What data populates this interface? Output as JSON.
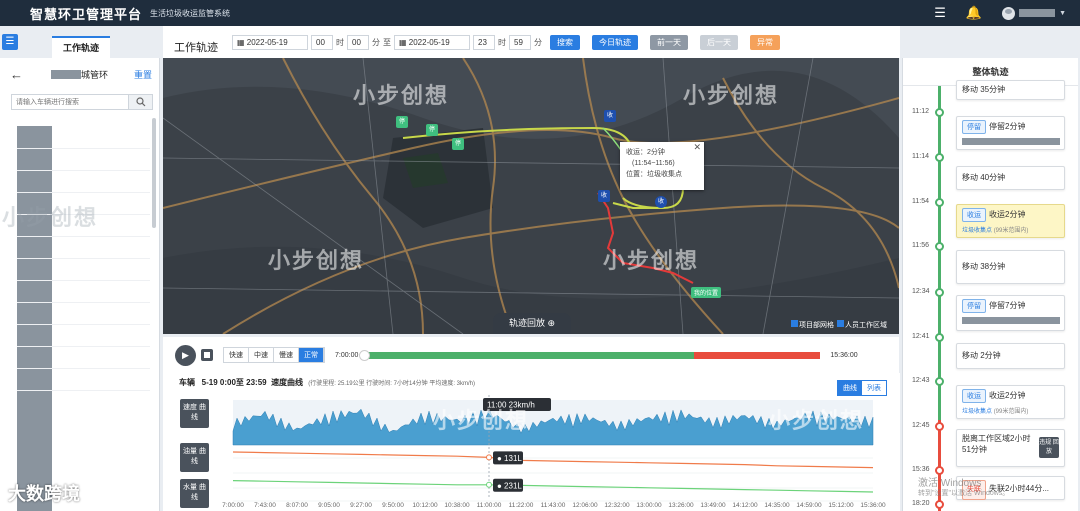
{
  "topbar": {
    "title": "智慧环卫管理平台",
    "subtitle": "生活垃圾收运监管系统",
    "menu_icon": "hamburger-icon",
    "bell_icon": "bell-icon",
    "avatar_icon": "user-avatar-icon"
  },
  "left_panel": {
    "tab_label": "工作轨迹",
    "vehicle_suffix": "城管环",
    "reset_label": "重置",
    "search_placeholder": "请输入车辆进行搜索"
  },
  "toolbar": {
    "title": "工作轨迹",
    "start_date": "2022-05-19",
    "start_hour": "00",
    "hour_unit": "时",
    "start_min": "00",
    "min_unit": "分",
    "to_label": "至",
    "end_date": "2022-05-19",
    "end_hour": "23",
    "end_min": "59",
    "search_btn": "搜索",
    "today_btn": "今日轨迹",
    "prev_btn": "前一天",
    "next_btn": "后一天",
    "exception_btn": "异常",
    "colors": {
      "primary": "#2a7de1",
      "gray": "#8e98a4",
      "disabled": "#c9cfd6",
      "orange": "#f5a15a"
    }
  },
  "map": {
    "popup_line1": "收运：2分钟",
    "popup_line2": "(11:54~11:56)",
    "popup_line3": "位置：垃圾收集点",
    "pos_label": "我的位置",
    "replay_label": "轨迹回放 ⊕",
    "check1": "项目部网格",
    "check2": "人员工作区域",
    "marker_stop": "停",
    "marker_collect": "收"
  },
  "player": {
    "speeds": [
      "快速",
      "中速",
      "慢速",
      "正常"
    ],
    "active_speed": "正常",
    "start_time": "7:00:00",
    "end_time": "15:36:00",
    "progress_fraction": 0.725,
    "colors": {
      "done": "#4cb06a",
      "remaining": "#e84c3d"
    }
  },
  "speed_chart": {
    "vehicle_label": "车辆",
    "range_label": "5-19 0:00至 23:59",
    "chart_title": "速度曲线",
    "meta": "(行驶里程: 25.19公里 行驶时间: 7小时14分钟 平均速度: 3km/h)",
    "toggle_chart": "曲线",
    "toggle_table": "列表",
    "side_speed": "速度 曲线",
    "side_oil": "油量 曲线",
    "side_water": "水量 曲线",
    "tooltip_speed": "11:00 23km/h",
    "tooltip_oil": "131L",
    "tooltip_water": "231L"
  },
  "chart_data": {
    "type": "line",
    "x": [
      "7:00:00",
      "7:43:00",
      "8:07:00",
      "9:05:00",
      "9:27:00",
      "9:50:00",
      "10:12:00",
      "10:38:00",
      "11:00:00",
      "11:22:00",
      "11:43:00",
      "12:06:00",
      "12:32:00",
      "13:00:00",
      "13:26:00",
      "13:49:00",
      "14:12:00",
      "14:35:00",
      "14:59:00",
      "15:12:00",
      "15:36:00"
    ],
    "series": [
      {
        "name": "速度曲线",
        "values": [
          20,
          28,
          14,
          26,
          30,
          12,
          27,
          22,
          29,
          15,
          23,
          25,
          18,
          24,
          28,
          21,
          26,
          19,
          27,
          24,
          22
        ]
      },
      {
        "name": "油量曲线",
        "values": [
          145,
          144,
          143,
          142,
          141,
          140,
          139,
          138,
          136,
          131,
          130,
          129,
          128,
          127,
          126,
          125,
          124,
          122,
          121,
          120,
          119
        ]
      },
      {
        "name": "水量曲线",
        "values": [
          239,
          238,
          237,
          236,
          235,
          234,
          233,
          232,
          232,
          231,
          230,
          229,
          228,
          227,
          226,
          225,
          224,
          223,
          222,
          221,
          220
        ]
      }
    ],
    "xlabel": "",
    "ylabel": "",
    "grid": true
  },
  "right_panel": {
    "title": "整体轨迹",
    "items": [
      {
        "time": "",
        "tag": "",
        "text": "移动 35分钟",
        "sub": ""
      },
      {
        "time": "11:12",
        "tag": "停留",
        "text": "停留2分钟",
        "sub": ""
      },
      {
        "time": "11:14",
        "tag": "",
        "text": "移动 40分钟",
        "sub": ""
      },
      {
        "time": "11:54",
        "tag": "收运",
        "text": "收运2分钟",
        "sub": "垃圾收集点",
        "sub2": "(99米范围内)"
      },
      {
        "time": "11:56",
        "tag": "",
        "text": "移动 38分钟",
        "sub": ""
      },
      {
        "time": "12:34",
        "tag": "停留",
        "text": "停留7分钟",
        "sub": ""
      },
      {
        "time": "12:41",
        "tag": "",
        "text": "移动 2分钟",
        "sub": ""
      },
      {
        "time": "12:43",
        "tag": "收运",
        "text": "收运2分钟",
        "sub": "垃圾收集点",
        "sub2": "(99米范围内)"
      },
      {
        "time": "12:45",
        "tag": "",
        "text": "脱离工作区域2小时51分钟",
        "sub": "",
        "btn": "违规 回放"
      },
      {
        "time": "15:36",
        "tag": "失联",
        "text": "失联2小时44分...",
        "sub": ""
      },
      {
        "time": "18:20",
        "tag": "",
        "text": "",
        "sub": ""
      }
    ]
  },
  "watermark": {
    "text": "小步创想",
    "corner": "大数跨境"
  },
  "windows_notice": {
    "line1": "激活 Windows",
    "line2": "转到\"设置\"以激活 Windows。"
  }
}
